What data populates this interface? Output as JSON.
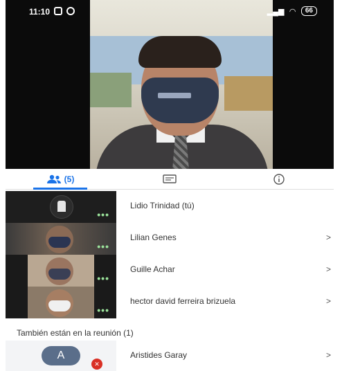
{
  "status_bar": {
    "time": "11:10",
    "battery": "66"
  },
  "tabs": {
    "people_count": "(5)"
  },
  "participants": [
    {
      "name": "Lidio Trinidad (tú)",
      "has_chevron": false
    },
    {
      "name": "Lilian Genes",
      "has_chevron": true
    },
    {
      "name": "Guille Achar",
      "has_chevron": true
    },
    {
      "name": "hector david ferreira brizuela",
      "has_chevron": true
    }
  ],
  "chevron_glyph": ">",
  "speaking_dots": "•••",
  "also_in_meeting": {
    "title": "También están en la reunión (1)",
    "avatar_letter": "A",
    "name": "Aristides Garay"
  },
  "colors": {
    "accent": "#1a73e8",
    "muted_mic": "#d93025"
  }
}
